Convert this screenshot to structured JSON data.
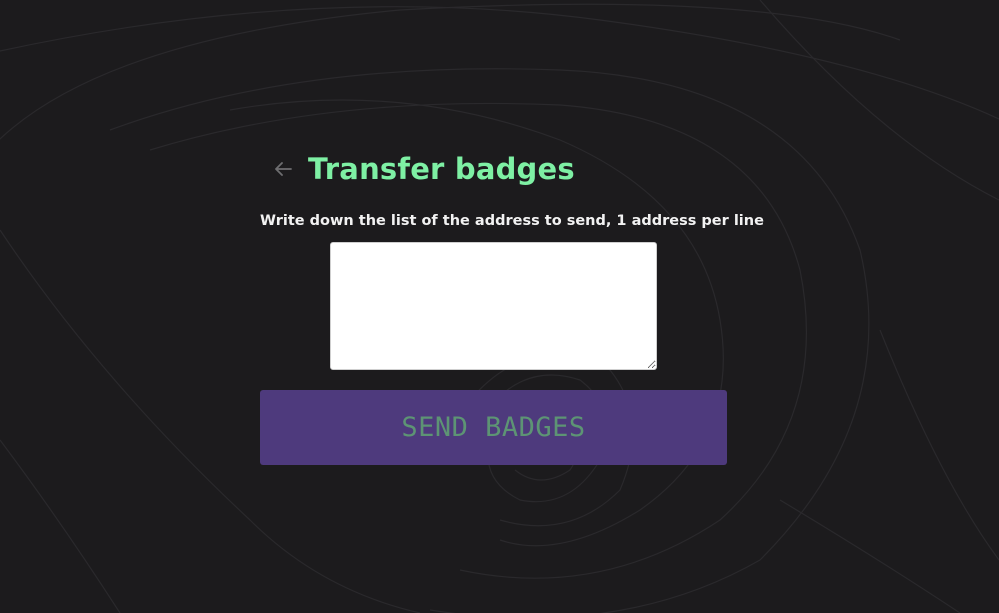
{
  "page": {
    "title": "Transfer badges",
    "back_icon": "arrow-left-icon",
    "instructions": "Write down the list of the address to send, 1 address per line"
  },
  "form": {
    "addresses_value": "",
    "addresses_placeholder": "",
    "send_label": "SEND BADGES",
    "send_enabled": false
  },
  "colors": {
    "background": "#1c1b1d",
    "title": "#7ef0a4",
    "button_bg": "#4e3a7d",
    "button_text": "#5d9474"
  }
}
